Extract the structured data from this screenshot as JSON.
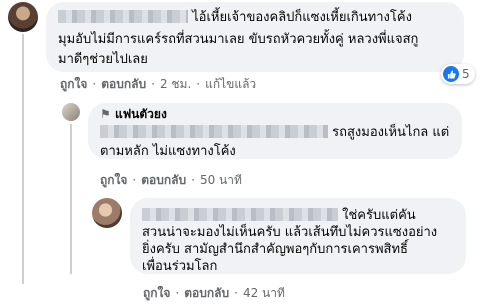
{
  "comment1": {
    "lines": [
      "ไอ้เหี้ยเจ้าของคลิปก็แซงเหี้ยเกินทางโค้ง",
      "มุมอับไม่มีการแคร์รถที่สวนมาเลย ขับรถหัวควยทั้งคู่ หลวงพี่แจสกู",
      "มาดีๆช่วยไปเลย"
    ],
    "actions": {
      "like": "ถูกใจ",
      "reply": "ตอบกลับ",
      "time": "2 ชม.",
      "edited": "แก้ไขแล้ว"
    },
    "reaction_count": "5"
  },
  "comment2": {
    "badge": "แฟนตัวยง",
    "lines": [
      "รถสูงมองเห็นไกล แต่",
      "ตามหลัก ไม่แซงทางโค้ง"
    ],
    "actions": {
      "like": "ถูกใจ",
      "reply": "ตอบกลับ",
      "time": "50 นาที"
    }
  },
  "comment3": {
    "lines": [
      "ใช่ครับแต่คัน",
      "สวนน่าจะมองไม่เห็นครับ แล้วเส้นทึบไม่ควรแซงอย่าง",
      "ยิ่งครับ สามัญสำนึกสำคัญพอๆกับการเคารพสิทธิ์",
      "เพื่อนร่วมโลก"
    ],
    "actions": {
      "like": "ถูกใจ",
      "reply": "ตอบกลับ",
      "time": "42 นาที"
    }
  },
  "colors": {
    "bubble": "#f0f2f5",
    "meta": "#65676b",
    "like_badge": "#1877f2"
  },
  "icons": [
    "like-icon",
    "fan-badge-icon"
  ]
}
